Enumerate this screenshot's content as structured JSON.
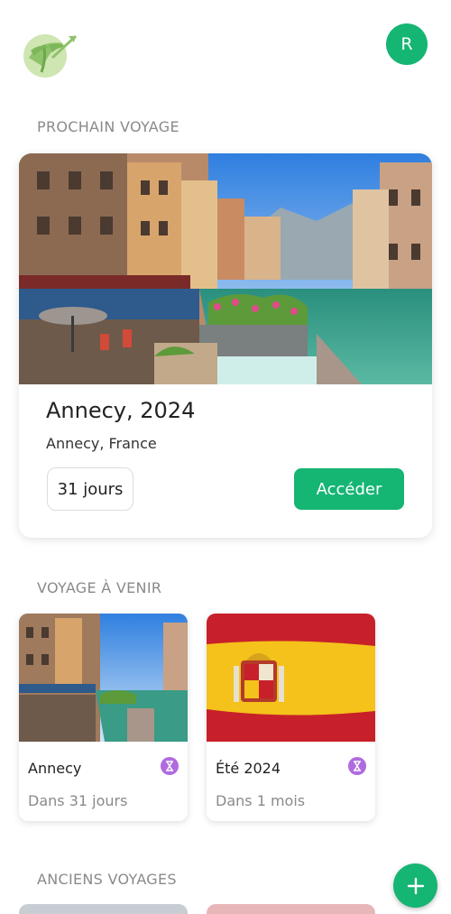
{
  "header": {
    "avatar_initial": "R"
  },
  "sections": {
    "next_trip": "PROCHAIN VOYAGE",
    "upcoming": "VOYAGE À VENIR",
    "past": "ANCIENS VOYAGES"
  },
  "next_trip": {
    "title": "Annecy, 2024",
    "location": "Annecy, France",
    "countdown": "31 jours",
    "action_label": "Accéder",
    "image_alt": "Annecy canal"
  },
  "upcoming_trips": [
    {
      "name": "Annecy",
      "when": "Dans 31 jours",
      "icon": "hourglass-icon"
    },
    {
      "name": "Été 2024",
      "when": "Dans 1 mois",
      "icon": "hourglass-icon"
    }
  ],
  "colors": {
    "accent": "#15b573",
    "timer": "#b06be0",
    "muted": "#8a8a8a"
  }
}
